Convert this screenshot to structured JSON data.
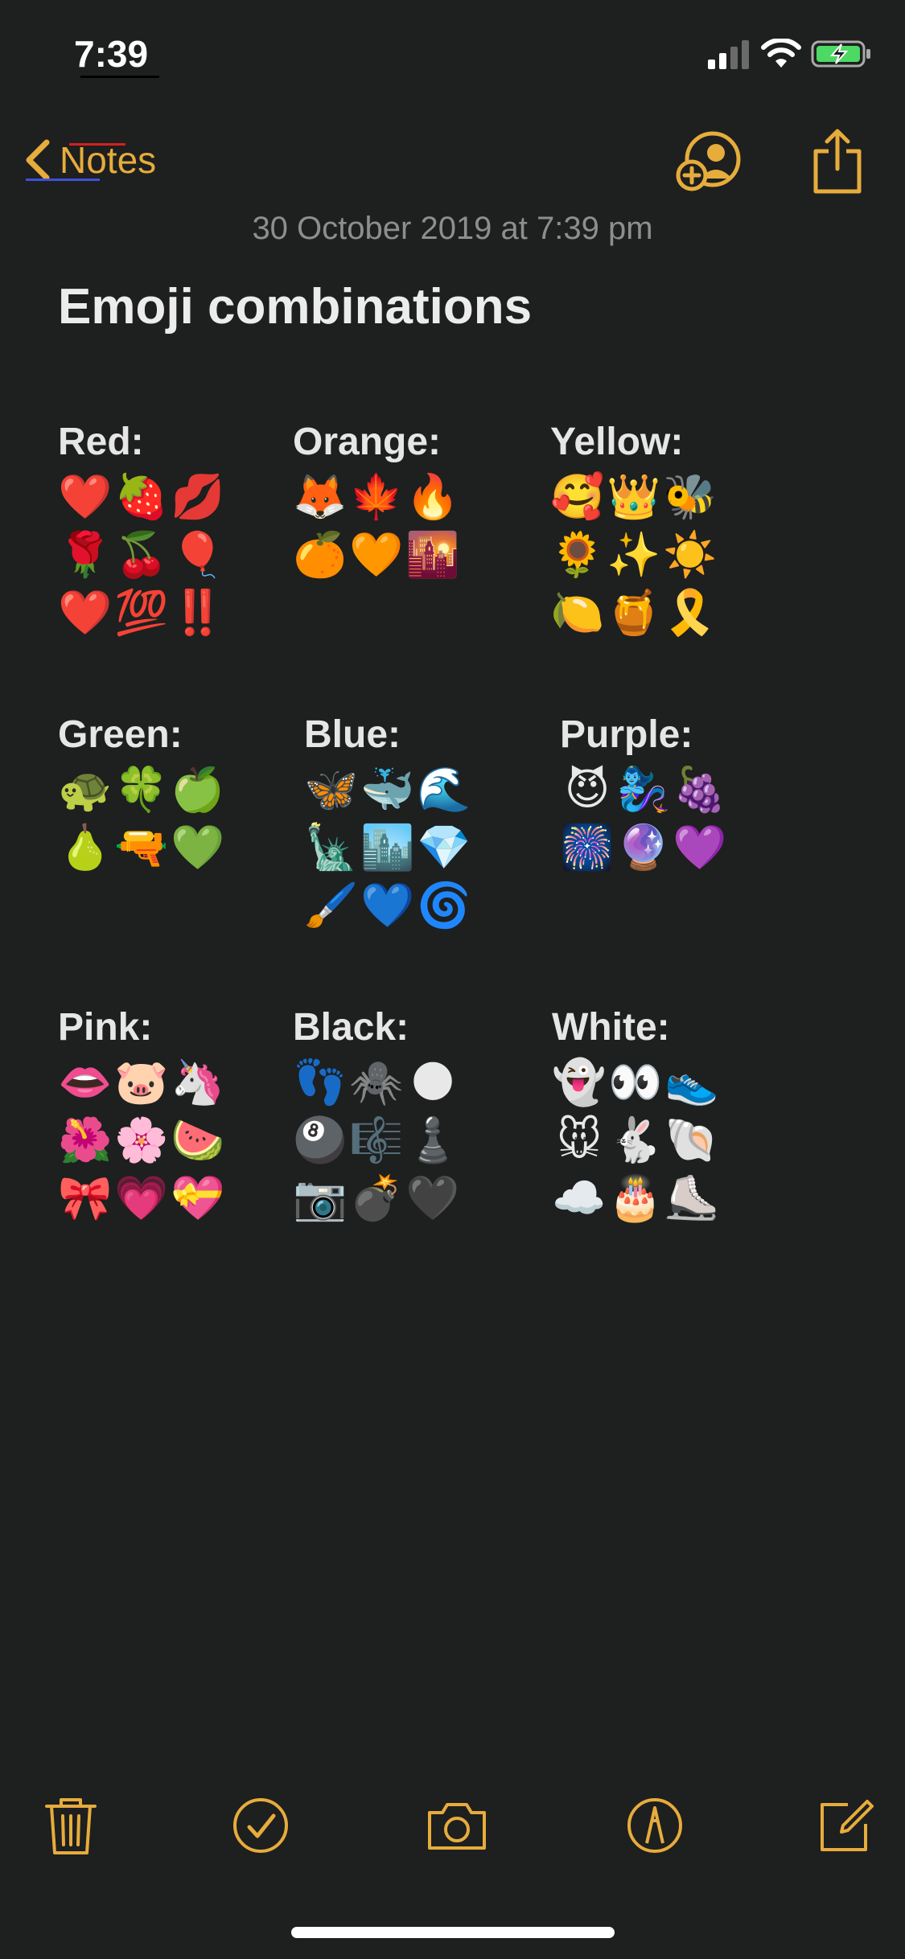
{
  "status": {
    "time": "7:39"
  },
  "nav": {
    "back_label": "Notes"
  },
  "note": {
    "date": "30 October 2019 at 7:39 pm",
    "title": "Emoji combinations"
  },
  "groups": [
    {
      "label": "Red:",
      "emojis": [
        "❤️",
        "🍓",
        "💋",
        "🌹",
        "🍒",
        "🎈",
        "❤️",
        "💯",
        "‼️"
      ]
    },
    {
      "label": "Orange:",
      "emojis": [
        "🦊",
        "🍁",
        "🔥",
        "🍊",
        "🧡",
        "🌇"
      ]
    },
    {
      "label": "Yellow:",
      "emojis": [
        "🥰",
        "👑",
        "🐝",
        "🌻",
        "✨",
        "☀️",
        "🍋",
        "🍯",
        "🎗️"
      ]
    },
    {
      "label": "Green:",
      "emojis": [
        "🐢",
        "🍀",
        "🍏",
        "🍐",
        "🔫",
        "💚"
      ]
    },
    {
      "label": "Blue:",
      "emojis": [
        "🦋",
        "🐳",
        "🌊",
        "🗽",
        "🏙️",
        "💎",
        "🖌️",
        "💙",
        "🌀"
      ]
    },
    {
      "label": "Purple:",
      "emojis": [
        "😈",
        "🧞‍♀️",
        "🍇",
        "🎆",
        "🔮",
        "💜"
      ]
    },
    {
      "label": "Pink:",
      "emojis": [
        "👄",
        "🐷",
        "🦄",
        "🌺",
        "🌸",
        "🍉",
        "🎀",
        "💗",
        "💝"
      ]
    },
    {
      "label": "Black:",
      "emojis": [
        "👣",
        "🕷️",
        "🌑",
        "🎱",
        "🎼",
        "♟️",
        "📷",
        "💣",
        "🖤"
      ]
    },
    {
      "label": "White:",
      "emojis": [
        "👻",
        "👀",
        "👟",
        "🐭",
        "🐇",
        "🐚",
        "☁️",
        "🎂",
        "⛸️"
      ]
    }
  ],
  "icons": {
    "back": "chevron-left-icon",
    "add_person": "add-person-icon",
    "share": "share-icon",
    "trash": "trash-icon",
    "checklist": "checkmark-circle-icon",
    "camera": "camera-icon",
    "markup": "markup-pen-icon",
    "compose": "compose-icon"
  },
  "colors": {
    "accent": "#e6ac3c",
    "background": "#1e1f1f",
    "battery": "#4cd964"
  }
}
